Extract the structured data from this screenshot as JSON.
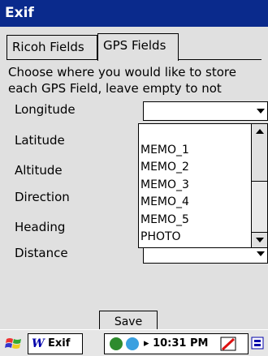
{
  "window": {
    "title": "Exif"
  },
  "tabs": [
    {
      "label": "Ricoh Fields",
      "active": false
    },
    {
      "label": "GPS Fields",
      "active": true
    }
  ],
  "description": "Choose where you would like to store each GPS Field, leave empty to not",
  "fields": [
    {
      "label": "Longitude",
      "value": ""
    },
    {
      "label": "Latitude",
      "value": ""
    },
    {
      "label": "Altitude",
      "value": ""
    },
    {
      "label": "Direction",
      "value": ""
    },
    {
      "label": "Heading",
      "value": ""
    },
    {
      "label": "Distance",
      "value": ""
    }
  ],
  "dropdown": {
    "options": [
      "",
      "MEMO_1",
      "MEMO_2",
      "MEMO_3",
      "MEMO_4",
      "MEMO_5",
      "PHOTO"
    ]
  },
  "buttons": {
    "save": "Save"
  },
  "taskbar": {
    "app_label": "Exif",
    "time": "10:31 PM"
  },
  "colors": {
    "titlebar": "#0a2a8c",
    "background": "#e0e0e0"
  }
}
